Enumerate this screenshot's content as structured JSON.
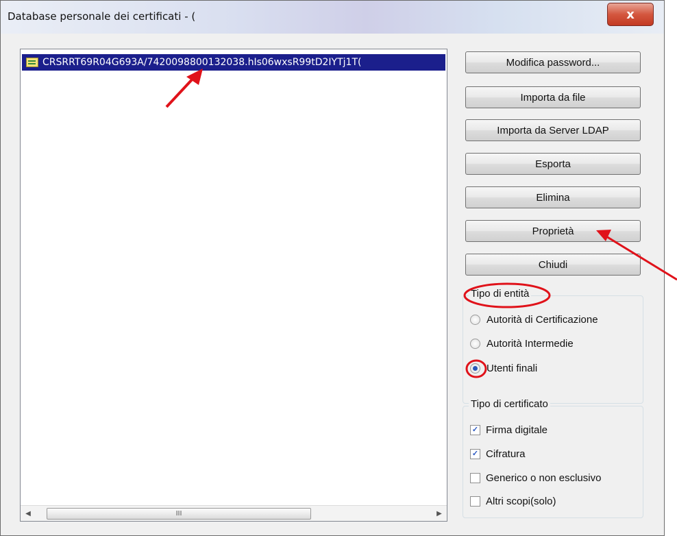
{
  "window": {
    "title": "Database personale dei certificati - (",
    "close_glyph": "x"
  },
  "certificates": {
    "items": [
      {
        "label": "CRSRRT69R04G693A/7420098800132038.hIs06wxsR99tD2IYTj1T(",
        "selected": true
      }
    ],
    "scroll_left_glyph": "◀",
    "scroll_right_glyph": "▶",
    "scroll_thumb_grip": "III"
  },
  "buttons": {
    "modify_password": "Modifica password...",
    "import_file": "Importa da file",
    "import_ldap": "Importa da Server LDAP",
    "export": "Esporta",
    "delete": "Elimina",
    "properties": "Proprietà",
    "close": "Chiudi"
  },
  "entity_type": {
    "title": "Tipo di entità",
    "options": [
      {
        "label": "Autorità di Certificazione",
        "checked": false
      },
      {
        "label": "Autorità Intermedie",
        "checked": false
      },
      {
        "label": "Utenti finali",
        "checked": true
      }
    ]
  },
  "cert_type": {
    "title": "Tipo di certificato",
    "options": [
      {
        "label": "Firma digitale",
        "checked": true
      },
      {
        "label": "Cifratura",
        "checked": true
      },
      {
        "label": "Generico o non esclusivo",
        "checked": false
      },
      {
        "label": "Altri scopi(solo)",
        "checked": false
      }
    ]
  },
  "colors": {
    "selection": "#1b1f8c",
    "annotation": "#e0121a"
  }
}
